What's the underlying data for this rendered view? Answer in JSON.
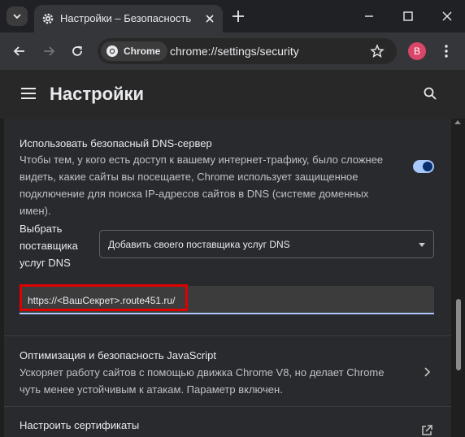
{
  "tab": {
    "title": "Настройки – Безопасность"
  },
  "toolbar": {
    "chip_label": "Chrome",
    "url": "chrome://settings/security",
    "avatar_letter": "B"
  },
  "header": {
    "title": "Настройки"
  },
  "dns": {
    "title": "Использовать безопасный DNS-сервер",
    "description": "Чтобы тем, у кого есть доступ к вашему интернет-трафику, было сложнее видеть, какие сайты вы посещаете, Chrome использует защищенное подключение для поиска IP-адресов сайтов в DNS (системе доменных имен).",
    "enabled": true,
    "provider_label": "Выбрать поставщика услуг DNS",
    "provider_value": "Добавить своего поставщика услуг DNS",
    "custom_value": "https://<ВашСекрет>.route451.ru/"
  },
  "javascript": {
    "title": "Оптимизация и безопасность JavaScript",
    "description": "Ускоряет работу сайтов с помощью движка Chrome V8, но делает Chrome чуть менее устойчивым к атакам. Параметр включен."
  },
  "certificates": {
    "title": "Настроить сертификаты"
  },
  "colors": {
    "accent": "#a8c7fa",
    "highlight": "#e00000",
    "avatar": "#d94668"
  }
}
